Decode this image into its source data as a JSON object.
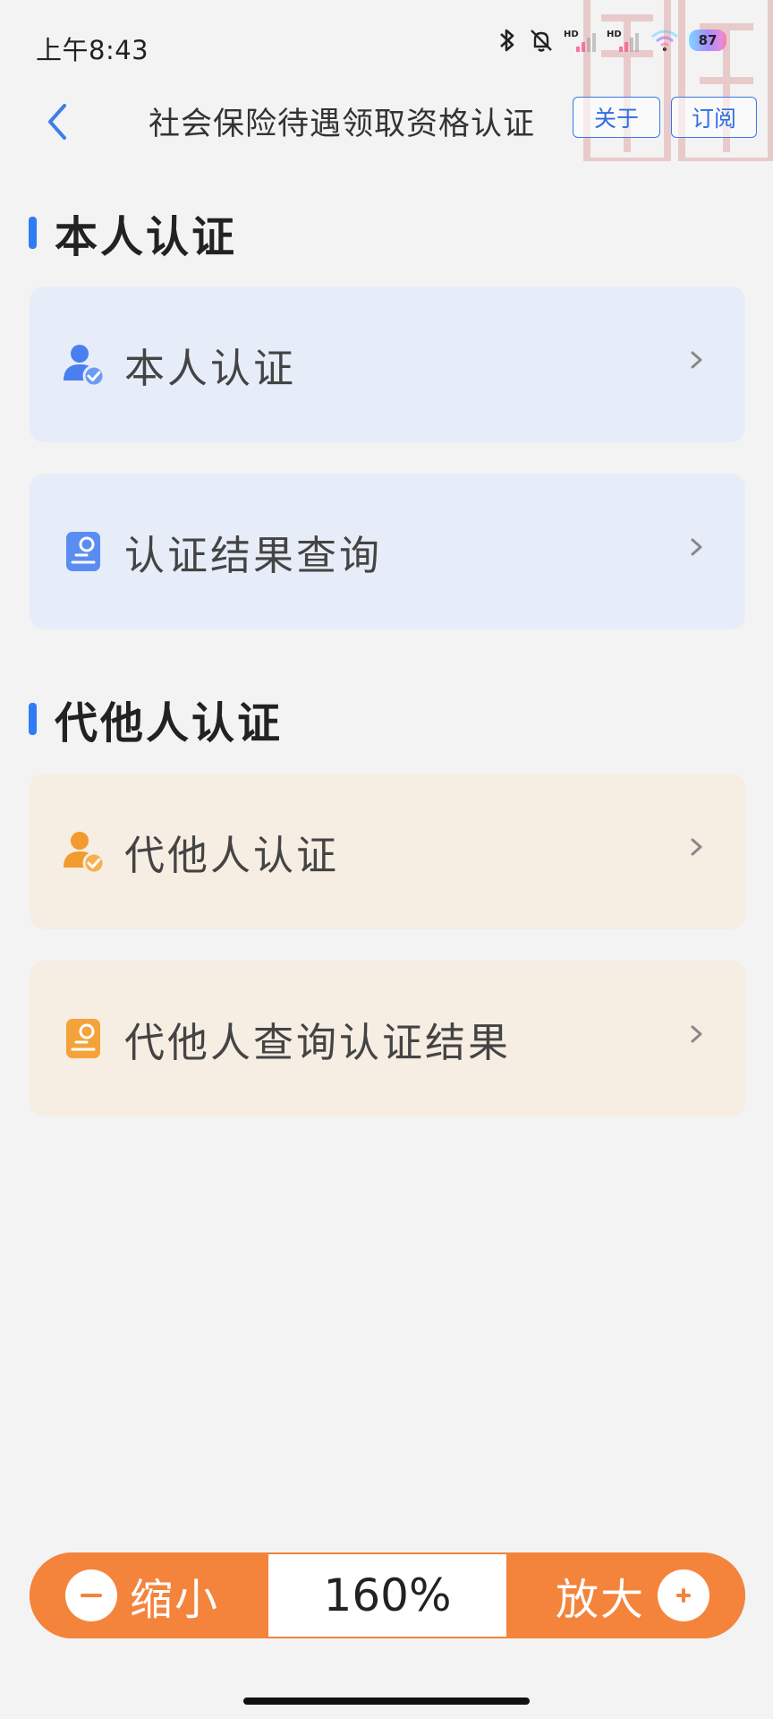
{
  "status_bar": {
    "time": "上午8:43",
    "battery": "87",
    "icons": [
      "bluetooth-icon",
      "mute-bell-icon",
      "hd-signal-icon",
      "hd-signal-icon",
      "wifi-icon",
      "battery-icon"
    ]
  },
  "header": {
    "title": "社会保险待遇领取资格认证",
    "about_label": "关于",
    "subscribe_label": "订阅"
  },
  "sections": [
    {
      "title": "本人认证",
      "accent": "#2f7cf6",
      "items": [
        {
          "label": "本人认证",
          "icon": "user-check-icon",
          "bg": "#e7edf8",
          "icon_color": "#4a7ff0"
        },
        {
          "label": "认证结果查询",
          "icon": "id-card-icon",
          "bg": "#e7edf8",
          "icon_color": "#4a7ff0"
        }
      ]
    },
    {
      "title": "代他人认证",
      "accent": "#2f7cf6",
      "items": [
        {
          "label": "代他人认证",
          "icon": "user-check-icon",
          "bg": "#f6ede3",
          "icon_color": "#f29a2e"
        },
        {
          "label": "代他人查询认证结果",
          "icon": "id-card-icon",
          "bg": "#f6ede3",
          "icon_color": "#f29a2e"
        }
      ]
    }
  ],
  "zoom": {
    "out_label": "缩小",
    "level": "160%",
    "in_label": "放大",
    "accent": "#f4843c"
  }
}
